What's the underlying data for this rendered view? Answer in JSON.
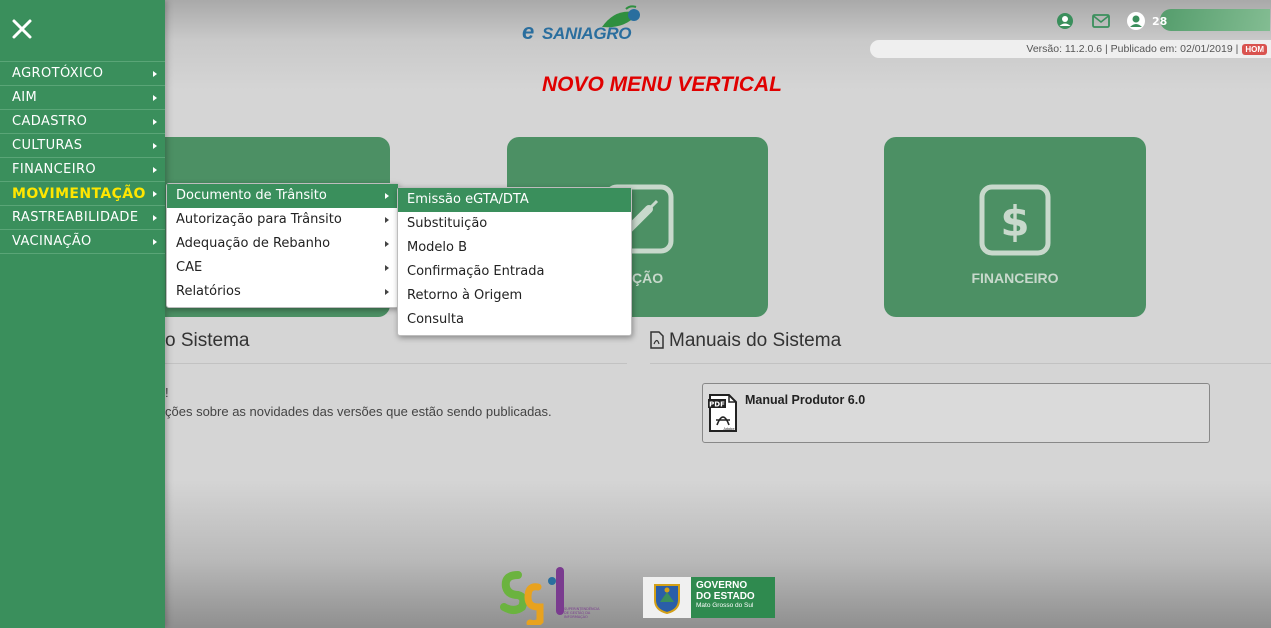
{
  "header": {
    "logo_prefix": "e",
    "logo_text": "SANIAGRO",
    "user_name": "28",
    "version_text": "Versão: 11.2.0.6 | Publicado em: 02/01/2019 |",
    "env_badge": "HOM",
    "icons": [
      "profile-icon",
      "mail-icon",
      "user-icon"
    ]
  },
  "banner": {
    "text": "NOVO MENU VERTICAL",
    "color": "#e00000"
  },
  "tiles": [
    {
      "label": ""
    },
    {
      "label": "NAÇÃO"
    },
    {
      "label": "FINANCEIRO"
    }
  ],
  "sections": {
    "news_title": "o Sistema",
    "news_line1": "!",
    "news_line2": "ções sobre as novidades das versões que estão sendo publicadas.",
    "manuals_title": "Manuais do Sistema",
    "manual_item": "Manual Produtor 6.0",
    "pdf_label": "PDF",
    "pdf_sub": "Adobe"
  },
  "sidebar": {
    "close_icon": "close-icon",
    "items": [
      {
        "label": "AGROTÓXICO"
      },
      {
        "label": "AIM"
      },
      {
        "label": "CADASTRO"
      },
      {
        "label": "CULTURAS"
      },
      {
        "label": "FINANCEIRO"
      },
      {
        "label": "MOVIMENTAÇÃO"
      },
      {
        "label": "RASTREABILIDADE"
      },
      {
        "label": "VACINAÇÃO"
      }
    ]
  },
  "submenu_movimentacao": [
    {
      "label": "Documento de Trânsito"
    },
    {
      "label": "Autorização para Trânsito"
    },
    {
      "label": "Adequação de Rebanho"
    },
    {
      "label": "CAE"
    },
    {
      "label": "Relatórios"
    }
  ],
  "submenu_documento": [
    {
      "label": "Emissão eGTA/DTA"
    },
    {
      "label": "Substituição"
    },
    {
      "label": "Modelo B"
    },
    {
      "label": "Confirmação Entrada"
    },
    {
      "label": "Retorno à Origem"
    },
    {
      "label": "Consulta"
    }
  ],
  "footer": {
    "sgi_caption": "SUPERINTENDÊNCIA DE GESTÃO DA INFORMAÇÃO",
    "gov_line1": "GOVERNO",
    "gov_line2": "DO ESTADO",
    "gov_line3": "Mato Grosso do Sul"
  },
  "colors": {
    "accent_green": "#3a8f5c",
    "active_menu_text": "#ffe600",
    "tile_green": "#4c9064"
  }
}
